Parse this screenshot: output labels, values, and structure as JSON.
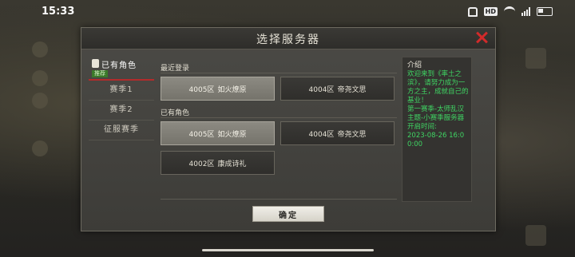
{
  "status_bar": {
    "time": "15:33",
    "icons": [
      "mute-bell-icon",
      "hd-icon",
      "wifi-icon",
      "signal-icon",
      "battery-icon"
    ]
  },
  "dialog": {
    "title": "选择服务器",
    "close_icon": "close-icon",
    "confirm_label": "确定"
  },
  "sidebar": {
    "active": {
      "label": "已有角色",
      "badge": "推荐"
    },
    "items": [
      {
        "label": "赛季1"
      },
      {
        "label": "赛季2"
      },
      {
        "label": "征服赛季"
      }
    ]
  },
  "recent": {
    "label": "最近登录",
    "servers": [
      {
        "num": "4005区",
        "name": "如火燎原",
        "selected": true
      },
      {
        "num": "4004区",
        "name": "帝尧文思",
        "selected": false
      }
    ]
  },
  "owned": {
    "label": "已有角色",
    "servers": [
      {
        "num": "4005区",
        "name": "如火燎原",
        "selected": true
      },
      {
        "num": "4004区",
        "name": "帝尧文思",
        "selected": false
      },
      {
        "num": "4002区",
        "name": "康成诗礼",
        "selected": false
      }
    ]
  },
  "intro": {
    "title": "介绍",
    "text": "欢迎来到《率土之滨》，请努力成为一方之主，成就自己的基业！\n第一赛季-太师乱汉主题-小赛季服务器\n开启时间:\n2023-08-26 16:00:00"
  },
  "colors": {
    "accent_red": "#d22a2a",
    "intro_text": "#3fd463",
    "selected_server_bg": "#8c8a82"
  }
}
